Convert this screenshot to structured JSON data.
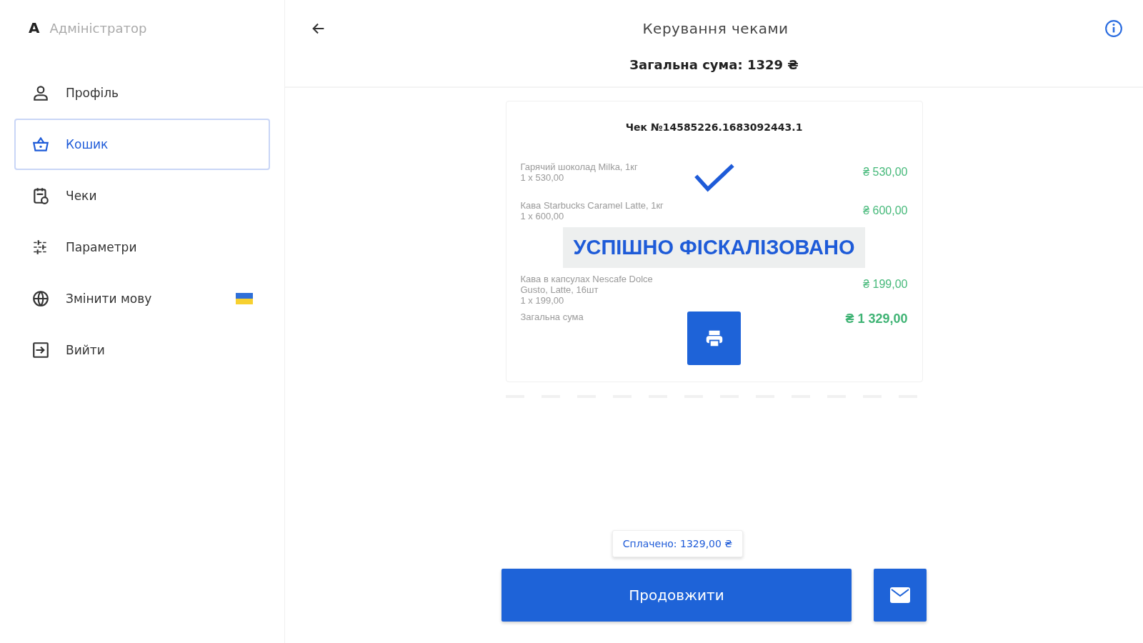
{
  "sidebar": {
    "user": {
      "initial": "A",
      "name": "Адміністратор"
    },
    "items": [
      {
        "label": "Профіль",
        "selected": false
      },
      {
        "label": "Кошик",
        "selected": true
      },
      {
        "label": "Чеки",
        "selected": false
      },
      {
        "label": "Параметри",
        "selected": false
      },
      {
        "label": "Змінити мову",
        "selected": false,
        "flag": true
      },
      {
        "label": "Вийти",
        "selected": false
      }
    ]
  },
  "header": {
    "title": "Керування чеками",
    "total": "Загальна сума: 1329 ₴"
  },
  "receipt": {
    "title": "Чек №14585226.1683092443.1",
    "items": [
      {
        "name": "Гарячий шоколад Milka, 1кг",
        "qty": "1 x 530,00",
        "amount": "₴ 530,00"
      },
      {
        "name": "Кава Starbucks Caramel Latte, 1кг",
        "qty": "1 x 600,00",
        "amount": "₴ 600,00"
      },
      {
        "name": "Кава в капсулах Nescafe Dolce Gusto, Latte, 16шт",
        "qty": "1 x 199,00",
        "amount": "₴ 199,00"
      }
    ],
    "total_label": "Загальна сума",
    "total": "₴ 1 329,00",
    "status": "УСПІШНО ФІСКАЛІЗОВАНО"
  },
  "paid": "Сплачено: 1329,00 ₴",
  "continue_button": "Продовжити"
}
